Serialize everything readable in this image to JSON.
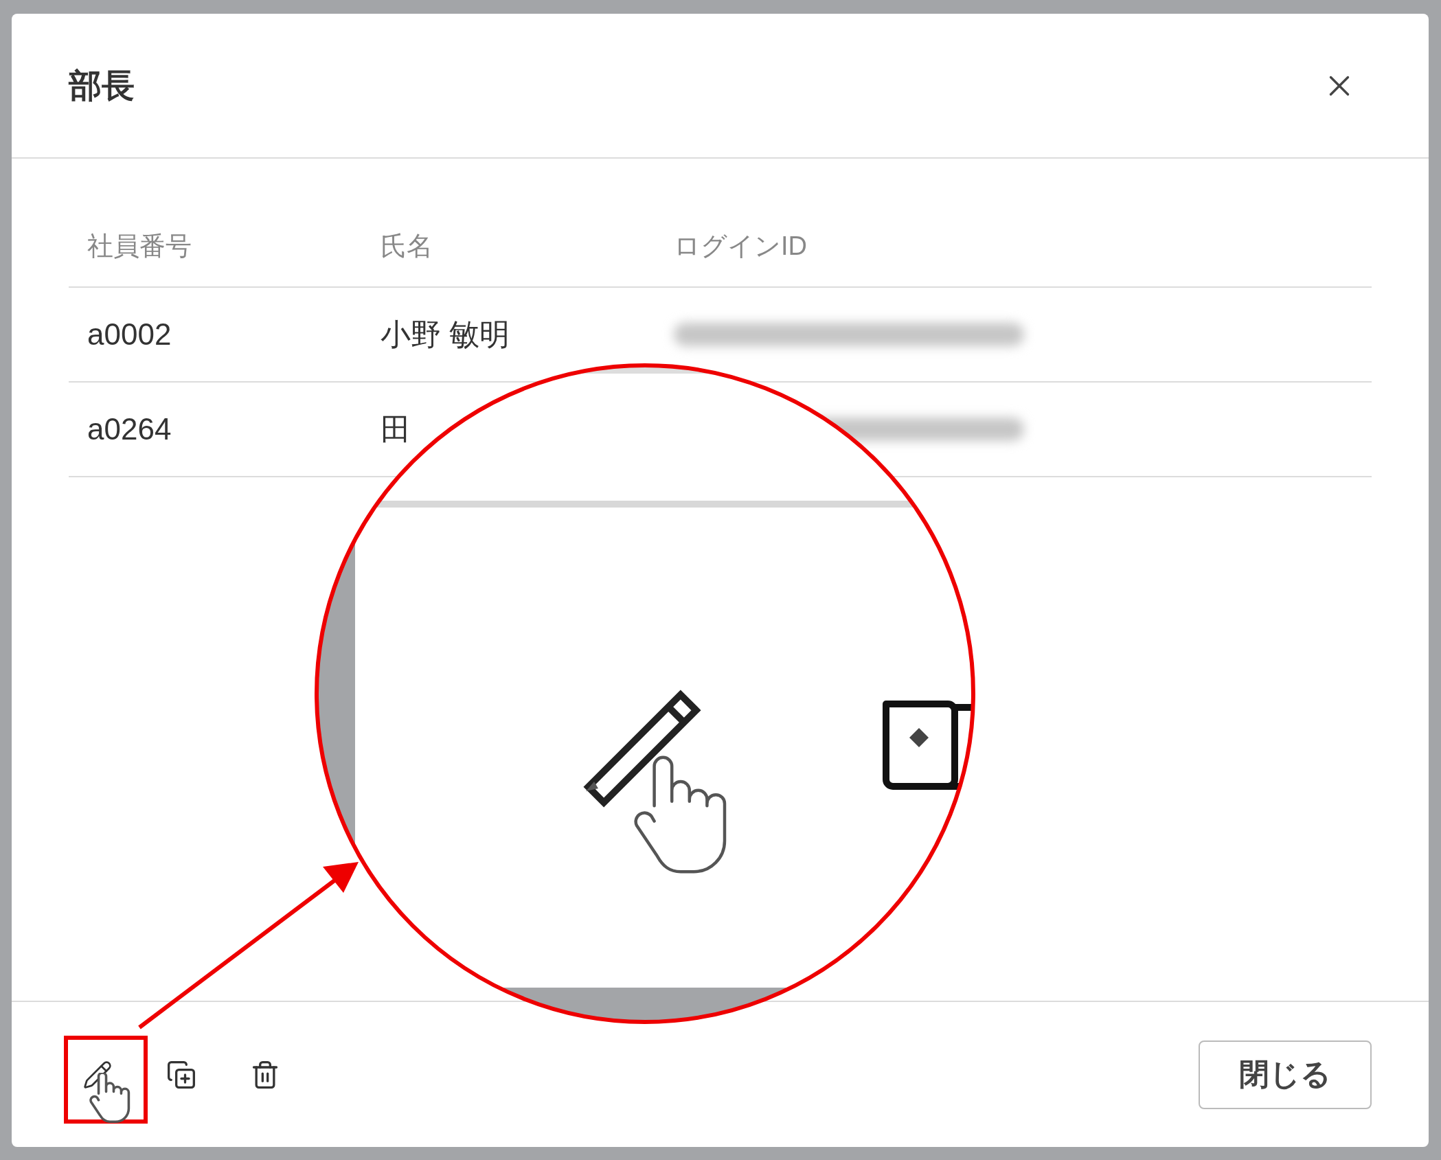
{
  "dialog": {
    "title": "部長"
  },
  "table": {
    "columns": [
      "社員番号",
      "氏名",
      "ログインID"
    ],
    "rows": [
      {
        "employee_no": "a0002",
        "name": "小野 敏明",
        "login_id_redacted": true
      },
      {
        "employee_no": "a0264",
        "name": "田",
        "login_id_redacted": true
      }
    ]
  },
  "footer": {
    "actions": [
      {
        "kind": "edit",
        "highlighted": true
      },
      {
        "kind": "copy",
        "highlighted": false
      },
      {
        "kind": "delete",
        "highlighted": false
      }
    ],
    "close_button": "閉じる"
  },
  "annotation": {
    "kind": "magnifier"
  }
}
